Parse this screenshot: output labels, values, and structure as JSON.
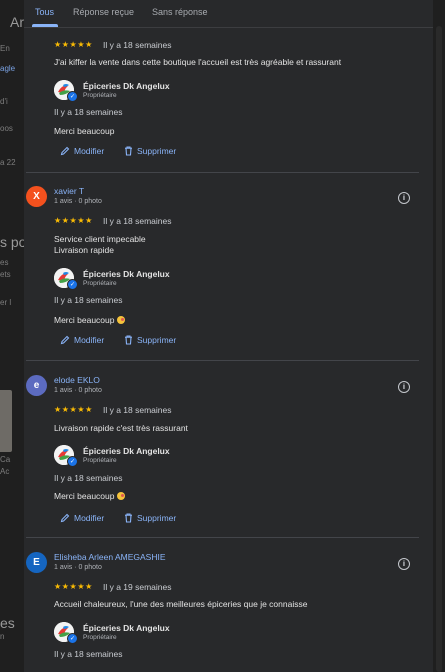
{
  "tabs": [
    {
      "label": "Tous"
    },
    {
      "label": "Réponse reçue"
    },
    {
      "label": "Sans réponse"
    }
  ],
  "background": {
    "fragments": [
      "Ar",
      "En",
      "agle",
      "d'i",
      "oos",
      "a 22",
      "s po",
      "es",
      "ets",
      "er l",
      "Ca",
      "Ac",
      "es",
      "n"
    ]
  },
  "colors": {
    "accent": "#8ab4f8",
    "star": "#fbbc04",
    "dialog_bg": "#28292b"
  },
  "owner": {
    "name": "Épiceries Dk Angelux",
    "role": "Propriétaire"
  },
  "actions": {
    "edit": "Modifier",
    "delete": "Supprimer"
  },
  "reviews": [
    {
      "stars": "★★★★★",
      "date": "Il y a 18 semaines",
      "text_lines": [
        "J'ai kiffer la vente dans cette boutique l'accueil est très agréable et rassurant"
      ],
      "reply_date": "Il y a 18 semaines",
      "reply_text": "Merci beaucoup",
      "reply_emoji": false
    },
    {
      "avatar_letter": "X",
      "avatar_color": "#f4511e",
      "name": "xavier T",
      "meta": "1 avis · 0 photo",
      "stars": "★★★★★",
      "date": "Il y a 18 semaines",
      "text_lines": [
        "Service client impecable",
        "Livraison rapide"
      ],
      "reply_date": "Il y a 18 semaines",
      "reply_text": "Merci beaucoup",
      "reply_emoji": true
    },
    {
      "avatar_letter": "e",
      "avatar_color": "#5c6bc0",
      "name": "elode EKLO",
      "meta": "1 avis · 0 photo",
      "stars": "★★★★★",
      "date": "Il y a 18 semaines",
      "text_lines": [
        "Livraison rapide c'est très rassurant"
      ],
      "reply_date": "Il y a 18 semaines",
      "reply_text": "Merci beaucoup",
      "reply_emoji": true
    },
    {
      "avatar_letter": "E",
      "avatar_color": "#1565c0",
      "name": "Elisheba Arleen AMEGASHIE",
      "meta": "1 avis · 0 photo",
      "stars": "★★★★★",
      "date": "Il y a 19 semaines",
      "text_lines": [
        "Accueil chaleureux, l'une des meilleures épiceries que je connaisse"
      ],
      "reply_date": "Il y a 18 semaines"
    }
  ]
}
